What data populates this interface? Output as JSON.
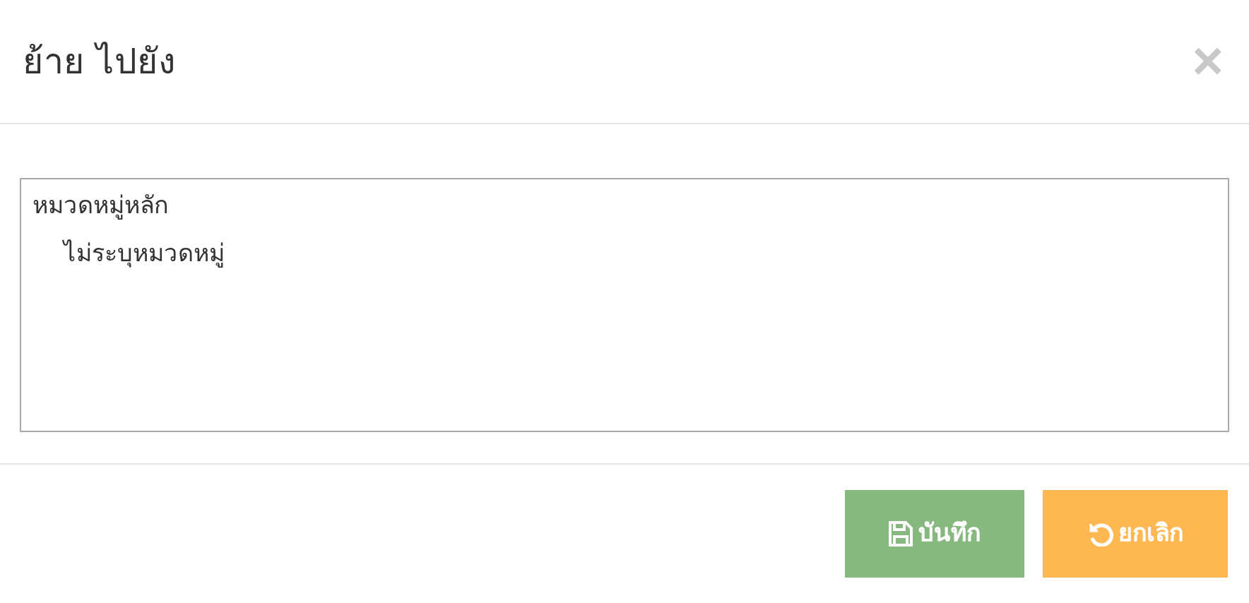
{
  "dialog": {
    "title": "ย้าย ไปยัง",
    "close": "×"
  },
  "category_list": {
    "items": [
      {
        "label": "หมวดหมู่หลัก",
        "children": [
          {
            "label": "ไม่ระบุหมวดหมู่"
          }
        ]
      }
    ]
  },
  "buttons": [
    {
      "kind": "save",
      "label": "บันทึก"
    },
    {
      "kind": "cancel",
      "label": "ยกเลิก"
    }
  ]
}
